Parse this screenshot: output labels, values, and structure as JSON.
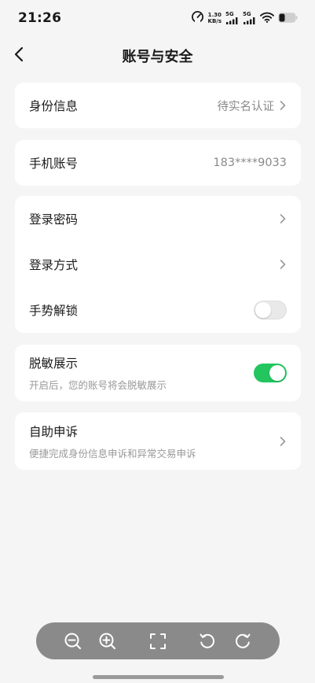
{
  "status_bar": {
    "time": "21:26",
    "net_speed_value": "1.30",
    "net_speed_unit": "KB/s",
    "sim1_label": "5G",
    "sim2_label": "5G"
  },
  "nav": {
    "title": "账号与安全"
  },
  "sections": {
    "identity": {
      "label": "身份信息",
      "value": "待实名认证"
    },
    "phone": {
      "label": "手机账号",
      "value": "183****9033"
    },
    "login_password": {
      "label": "登录密码"
    },
    "login_method": {
      "label": "登录方式"
    },
    "gesture_unlock": {
      "label": "手势解锁",
      "enabled": false
    },
    "desensitize": {
      "title": "脱敏展示",
      "subtitle": "开启后，您的账号将会脱敏展示",
      "enabled": true
    },
    "self_appeal": {
      "title": "自助申诉",
      "subtitle": "便捷完成身份信息申诉和异常交易申诉"
    }
  },
  "toolbar": {
    "buttons": [
      "zoom-out-icon",
      "zoom-in-icon",
      "fullscreen-icon",
      "rotate-left-icon",
      "rotate-right-icon"
    ]
  },
  "colors": {
    "accent_green": "#22c55e",
    "background": "#f5f5f5",
    "card": "#ffffff",
    "toolbar": "#8a8a8a"
  }
}
